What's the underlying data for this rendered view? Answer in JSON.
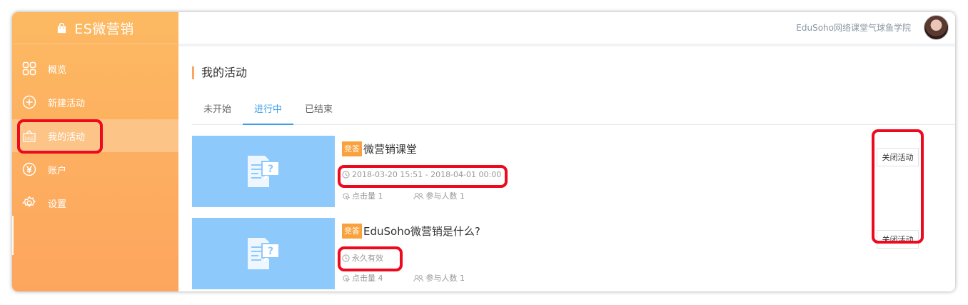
{
  "app": {
    "brand": "ES微营销"
  },
  "sidebar": {
    "items": [
      {
        "label": "概览",
        "icon": "grid-icon"
      },
      {
        "label": "新建活动",
        "icon": "plus-circle-icon"
      },
      {
        "label": "我的活动",
        "icon": "sale-tag-icon",
        "active": true
      },
      {
        "label": "账户",
        "icon": "yuan-circle-icon"
      },
      {
        "label": "设置",
        "icon": "gear-icon"
      }
    ]
  },
  "header": {
    "school_name": "EduSoho网络课堂气球鱼学院",
    "avatar": "user-avatar"
  },
  "main": {
    "title": "我的活动",
    "tabs": [
      {
        "label": "未开始",
        "active": false
      },
      {
        "label": "进行中",
        "active": true
      },
      {
        "label": "已结束",
        "active": false
      }
    ],
    "activities": [
      {
        "badge": "竞答",
        "title": "微营销课堂",
        "period": "2018-03-20 15:51 - 2018-04-01 00:00",
        "clicks_label": "点击量 1",
        "participants_label": "参与人数 1",
        "action_label": "关闭活动"
      },
      {
        "badge": "竞答",
        "title": "EduSoho微营销是什么?",
        "period": "永久有效",
        "clicks_label": "点击量 4",
        "participants_label": "参与人数 1",
        "action_label": "关闭活动"
      }
    ]
  },
  "colors": {
    "sidebar_top": "#fdb962",
    "sidebar_bottom": "#fda55e",
    "accent_blue": "#3a9cea",
    "badge": "#f9a13d",
    "highlight": "#ee0a1e",
    "thumb": "#8ec9fb"
  }
}
